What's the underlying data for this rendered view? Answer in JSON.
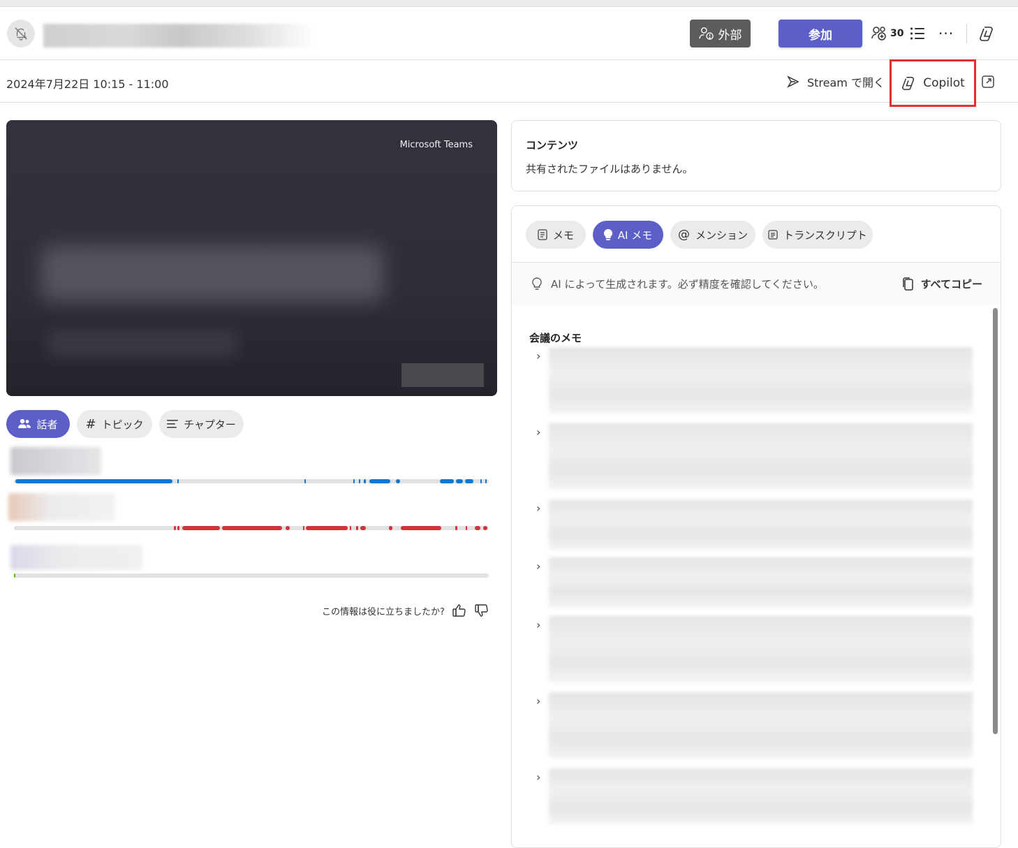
{
  "header": {
    "external_label": "外部",
    "join_label": "参加",
    "participants_count": "30",
    "more_label": "···"
  },
  "subheader": {
    "date_time": "2024年7月22日 10:15 - 11:00",
    "stream_label": "Stream で開く",
    "copilot_label": "Copilot"
  },
  "video": {
    "watermark": "Microsoft Teams"
  },
  "left_tabs": [
    {
      "label": "話者",
      "active": true
    },
    {
      "label": "トピック",
      "active": false
    },
    {
      "label": "チャプター",
      "active": false
    }
  ],
  "speakers": {
    "colors": [
      "#0f78d4",
      "#d13438",
      "#6bb700"
    ]
  },
  "feedback": {
    "question": "この情報は役に立ちましたか?"
  },
  "content_panel": {
    "title": "コンテンツ",
    "empty_message": "共有されたファイルはありません。"
  },
  "notes_panel": {
    "tabs": [
      {
        "label": "メモ",
        "active": false
      },
      {
        "label": "AI メモ",
        "active": true
      },
      {
        "label": "メンション",
        "active": false
      },
      {
        "label": "トランスクリプト",
        "active": false
      }
    ],
    "ai_disclaimer": "AI によって生成されます。必ず精度を確認してください。",
    "copy_all_label": "すべてコピー",
    "notes_title": "会議のメモ"
  },
  "colors": {
    "accent": "#5b5fc7",
    "highlight_box": "#e03030",
    "external_badge": "#5c5c5c"
  }
}
